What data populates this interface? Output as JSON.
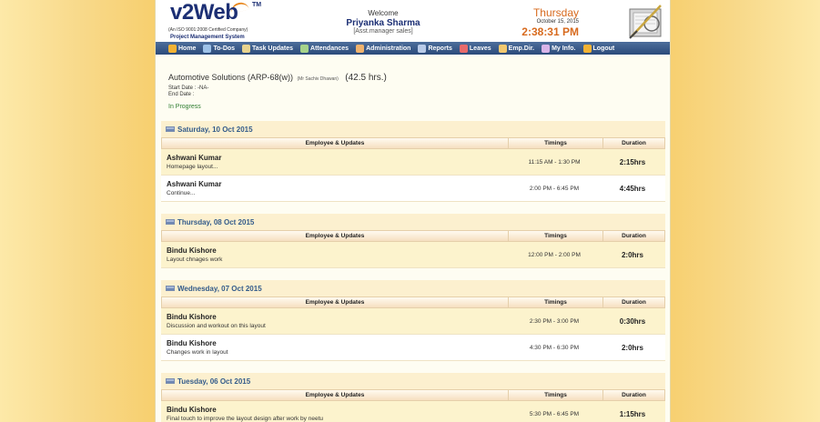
{
  "header": {
    "logo": "v2Web",
    "logo_tm": "TM",
    "logo_sub1": "(An ISO 9001:2008 Certified Company)",
    "logo_sub2": "Project Management System",
    "welcome": "Welcome",
    "user_name": "Priyanka Sharma",
    "user_role": "[Asst.manager sales]",
    "day": "Thursday",
    "date": "October 15, 2015",
    "time": "2:38:31 PM"
  },
  "nav": [
    {
      "label": "Home",
      "icon": "home-icon",
      "color": "#f2b233"
    },
    {
      "label": "To-Dos",
      "icon": "todo-icon",
      "color": "#9ec2e8"
    },
    {
      "label": "Task Updates",
      "icon": "task-icon",
      "color": "#e8d38e"
    },
    {
      "label": "Attendances",
      "icon": "attendance-icon",
      "color": "#a6d38a"
    },
    {
      "label": "Administration",
      "icon": "admin-icon",
      "color": "#f0b36e"
    },
    {
      "label": "Reports",
      "icon": "reports-icon",
      "color": "#b9cbe8"
    },
    {
      "label": "Leaves",
      "icon": "leaves-icon",
      "color": "#e86a6a"
    },
    {
      "label": "Emp.Dir.",
      "icon": "directory-icon",
      "color": "#f2c86e"
    },
    {
      "label": "My Info.",
      "icon": "user-icon",
      "color": "#d9b4e8"
    },
    {
      "label": "Logout",
      "icon": "logout-icon",
      "color": "#f2b233"
    }
  ],
  "project": {
    "title": "Automotive Solutions (ARP-68(w))",
    "lead": "(Mr Sachiv Dhawan)",
    "hours": "(42.5 hrs.)",
    "start_date": "Start Date : -NA-",
    "end_date": "End Date :",
    "status": "In Progress"
  },
  "columns": {
    "employee": "Employee & Updates",
    "timings": "Timings",
    "duration": "Duration"
  },
  "days": [
    {
      "title": "Saturday, 10 Oct 2015",
      "rows": [
        {
          "name": "Ashwani Kumar",
          "note": "Homepage layout...",
          "time": "11:15 AM - 1:30 PM",
          "duration": "2:15hrs"
        },
        {
          "name": "Ashwani Kumar",
          "note": "Continue...",
          "time": "2:00 PM - 6:45 PM",
          "duration": "4:45hrs"
        }
      ]
    },
    {
      "title": "Thursday, 08 Oct 2015",
      "rows": [
        {
          "name": "Bindu Kishore",
          "note": "Layout chnages work",
          "time": "12:00 PM - 2:00 PM",
          "duration": "2:0hrs"
        }
      ]
    },
    {
      "title": "Wednesday, 07 Oct 2015",
      "rows": [
        {
          "name": "Bindu Kishore",
          "note": "Discussion and workout on this layout",
          "time": "2:30 PM - 3:00 PM",
          "duration": "0:30hrs"
        },
        {
          "name": "Bindu Kishore",
          "note": "Changes work in layout",
          "time": "4:30 PM - 6:30 PM",
          "duration": "2:0hrs"
        }
      ]
    },
    {
      "title": "Tuesday, 06 Oct 2015",
      "rows": [
        {
          "name": "Bindu Kishore",
          "note": "Final touch to improve the layout design after work by neetu",
          "time": "5:30 PM - 6:45 PM",
          "duration": "1:15hrs"
        }
      ]
    }
  ]
}
